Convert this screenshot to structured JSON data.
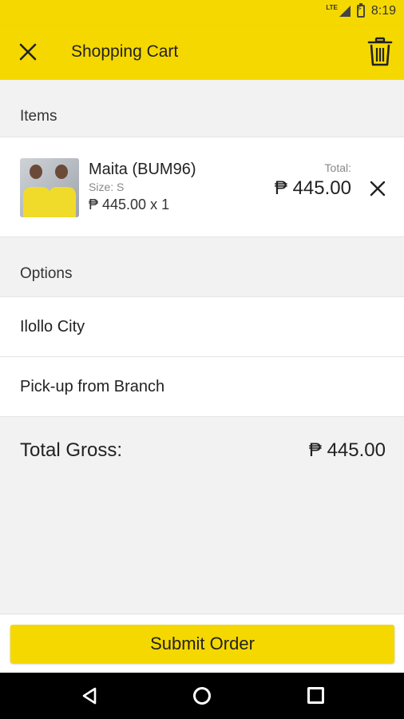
{
  "status_bar": {
    "network": "LTE",
    "time": "8:19"
  },
  "app_bar": {
    "title": "Shopping Cart"
  },
  "items_section": {
    "header": "Items",
    "items": [
      {
        "name": "Maita (BUM96)",
        "size": "Size: S",
        "price_qty": "₱ 445.00 x 1",
        "total_label": "Total:",
        "total": "₱ 445.00"
      }
    ]
  },
  "options_section": {
    "header": "Options",
    "options": [
      "Ilollo City",
      "Pick-up from Branch"
    ]
  },
  "summary": {
    "label": "Total Gross:",
    "value": "₱ 445.00"
  },
  "actions": {
    "submit_label": "Submit Order"
  },
  "colors": {
    "accent": "#f5d800",
    "background": "#f2f2f2"
  },
  "icons": [
    "close-icon",
    "trash-icon",
    "remove-item-icon",
    "nav-back-icon",
    "nav-home-icon",
    "nav-recents-icon"
  ]
}
